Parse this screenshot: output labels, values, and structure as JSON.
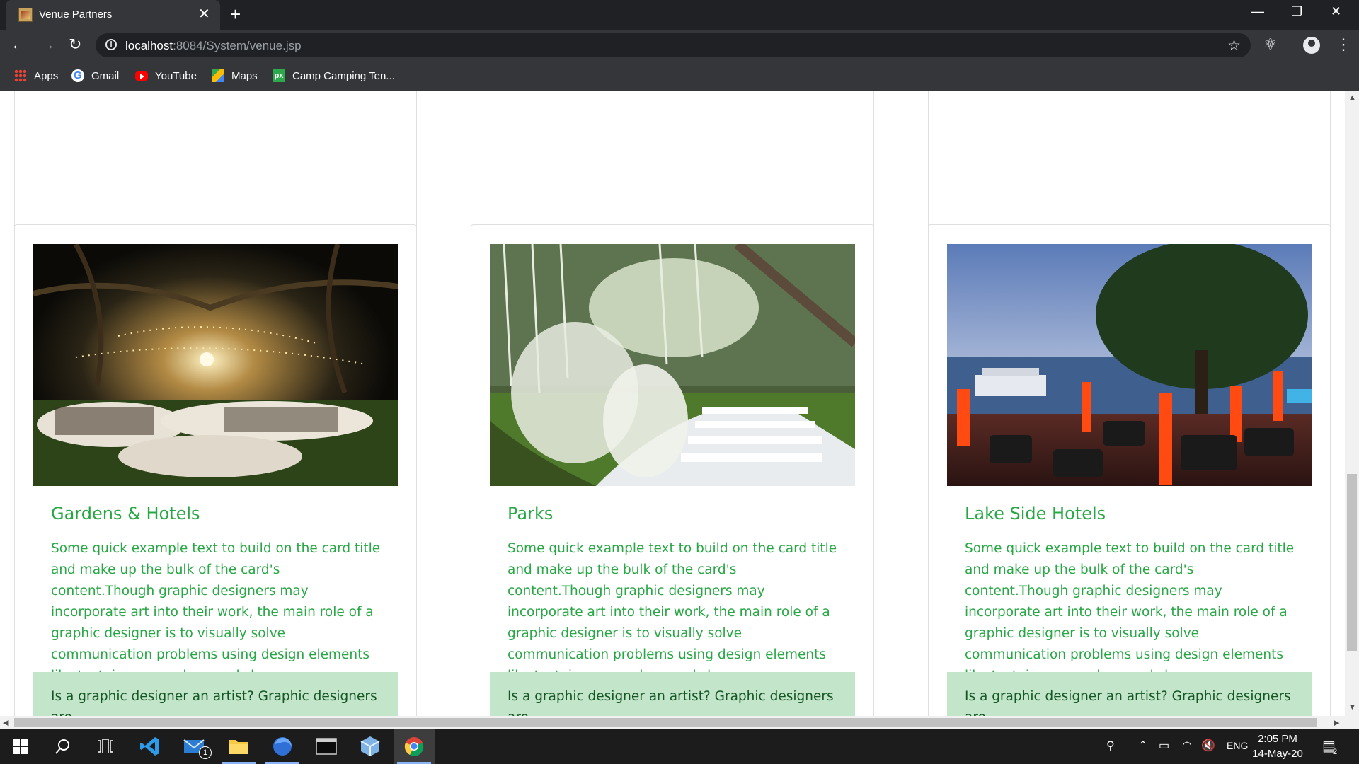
{
  "browser": {
    "tab_title": "Venue Partners",
    "url_host": "localhost",
    "url_path": ":8084/System/venue.jsp",
    "bookmarks": [
      {
        "label": "Apps",
        "icon": "apps-grid-icon"
      },
      {
        "label": "Gmail",
        "icon": "google-icon"
      },
      {
        "label": "YouTube",
        "icon": "youtube-icon"
      },
      {
        "label": "Maps",
        "icon": "maps-icon"
      },
      {
        "label": "Camp Camping Ten...",
        "icon": "px-icon"
      }
    ]
  },
  "cards": [
    {
      "title": "Gardens & Hotels",
      "image": "night garden dinner under string lights",
      "text": "Some quick example text to build on the card title and make up the bulk of the card's content.Though graphic designers may incorporate art into their work, the main role of a graphic designer is to visually solve communication problems using design elements like text, images, colors, and shapes.",
      "footer": "Is a graphic designer an artist? Graphic designers are"
    },
    {
      "title": "Parks",
      "image": "outdoor wedding aisle with white chairs and flowers",
      "text": "Some quick example text to build on the card title and make up the bulk of the card's content.Though graphic designers may incorporate art into their work, the main role of a graphic designer is to visually solve communication problems using design elements like text, images, colors, and shapes.",
      "footer": "Is a graphic designer an artist? Graphic designers are"
    },
    {
      "title": "Lake Side Hotels",
      "image": "lakeside hotel terrace with red lanterns at dusk",
      "text": "Some quick example text to build on the card title and make up the bulk of the card's content.Though graphic designers may incorporate art into their work, the main role of a graphic designer is to visually solve communication problems using design elements like text, images, colors, and shapes.",
      "footer": "Is a graphic designer an artist? Graphic designers are"
    }
  ],
  "colors": {
    "card_text": "#28a745",
    "footer_bg": "#c3e6cb",
    "footer_text": "#155724"
  },
  "taskbar": {
    "mail_badge": "1",
    "language": "ENG",
    "time": "2:05 PM",
    "date": "14-May-20",
    "notifications": "2"
  }
}
